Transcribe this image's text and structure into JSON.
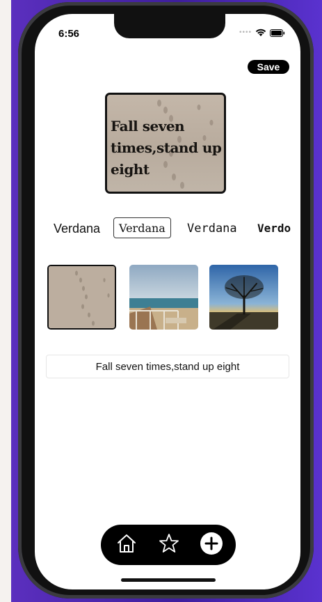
{
  "status_bar": {
    "time": "6:56",
    "signal_icon": "signal-dots",
    "wifi_icon": "wifi-icon",
    "battery_icon": "battery-icon"
  },
  "header": {
    "save_label": "Save"
  },
  "preview": {
    "quote": "Fall seven times,stand up eight",
    "background": "sand-footprints"
  },
  "fonts": {
    "options": [
      {
        "label": "Verdana",
        "selected": false
      },
      {
        "label": "Verdana",
        "selected": true
      },
      {
        "label": "Verdana",
        "selected": false
      },
      {
        "label": "Verdo",
        "selected": false
      }
    ]
  },
  "backgrounds": [
    {
      "name": "sand-footprints",
      "selected": true
    },
    {
      "name": "beach-boardwalk",
      "selected": false
    },
    {
      "name": "tree-sunset",
      "selected": false
    }
  ],
  "quote_input": {
    "value": "Fall seven times,stand up eight"
  },
  "tab_bar": {
    "items": [
      {
        "icon": "home-icon"
      },
      {
        "icon": "star-icon"
      },
      {
        "icon": "plus-circle-icon"
      }
    ]
  },
  "colors": {
    "accent": "#000000",
    "background": "#ffffff",
    "wallpaper": "#4a27b5"
  }
}
